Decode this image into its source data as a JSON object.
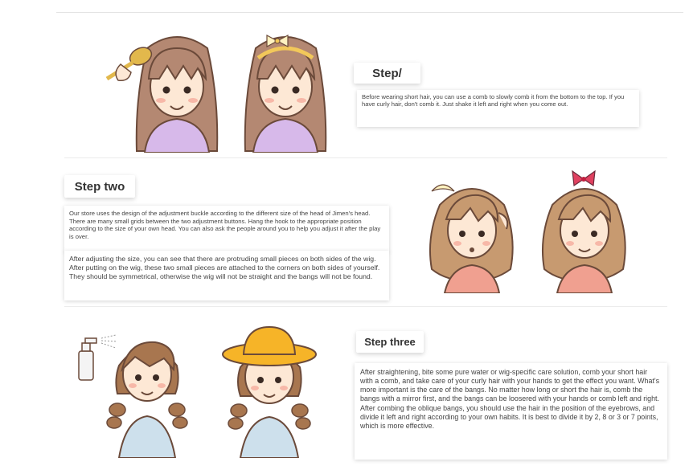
{
  "step1": {
    "title": "Step/",
    "text": "Before wearing short hair, you can use a comb to slowly comb it from the bottom to the top. If you have curly hair, don't comb it. Just shake it left and right when you come out."
  },
  "step2": {
    "title": "Step two",
    "text1": "Our store uses the design of the adjustment buckle according to the different size of the head of Jimen's head. There are many small grids between the two adjustment buttons. Hang the hook to the appropriate position according to the size of your own head. You can also ask the people around you to help you adjust it after the play is over.",
    "text2": "After adjusting the size, you can see that there are protruding small pieces on both sides of the wig. After putting on the wig, these two small pieces are attached to the corners on both sides of yourself. They should be symmetrical, otherwise the wig will not be straight and the bangs will not be found."
  },
  "step3": {
    "title": "Step three",
    "text": "After straightening, bite some pure water or wig-specific care solution, comb your short hair with a comb, and take care of your curly hair with your hands to get the effect you want. What's more important is the care of the bangs. No matter how long or short the hair is, comb the bangs with a mirror first, and the bangs can be loosered with your hands or comb left and right. After combing the oblique bangs, you should use the hair in the position of the eyebrows, and divide it left and right according to your own habits. It is best to divide it by 2, 8 or 3 or 7 points, which is more effective."
  },
  "colors": {
    "straight_hair": "#b48872",
    "wavy_hair": "#c79a70",
    "braid_hair": "#a8764f",
    "skin": "#fde8d5",
    "lavender_top": "#d7b9ea",
    "pink_top": "#f0a090",
    "blue_top": "#cde0ec",
    "hat": "#f6b428",
    "comb": "#e2b84c"
  },
  "icons": [
    "comb-icon",
    "bow-headband-icon",
    "hair-clip-icon",
    "red-bow-icon",
    "spray-bottle-icon",
    "sun-hat-icon"
  ]
}
